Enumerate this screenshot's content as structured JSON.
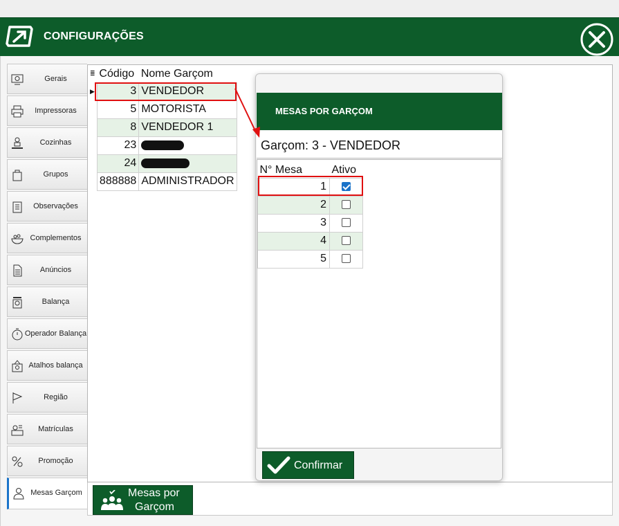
{
  "window": {
    "title": "CONFIGURAÇÕES"
  },
  "sidebar": {
    "items": [
      {
        "label": "Gerais",
        "icon": "gear-screen-icon"
      },
      {
        "label": "Impressoras",
        "icon": "printer-icon"
      },
      {
        "label": "Cozinhas",
        "icon": "chef-icon"
      },
      {
        "label": "Grupos",
        "icon": "groups-icon"
      },
      {
        "label": "Observações",
        "icon": "clipboard-icon"
      },
      {
        "label": "Complementos",
        "icon": "bowl-icon"
      },
      {
        "label": "Anúncios",
        "icon": "document-icon"
      },
      {
        "label": "Balança",
        "icon": "scale-icon"
      },
      {
        "label": "Operador  Balança",
        "icon": "stopwatch-icon"
      },
      {
        "label": "Atalhos balança",
        "icon": "scale-shortcut-icon"
      },
      {
        "label": "Região",
        "icon": "flag-icon"
      },
      {
        "label": "Matrículas",
        "icon": "badge-icon"
      },
      {
        "label": "Promoção",
        "icon": "promotion-icon"
      },
      {
        "label": "Mesas Garçom",
        "icon": "waiter-icon"
      }
    ]
  },
  "waiters_grid": {
    "headers": {
      "code": "Código",
      "name": "Nome Garçom"
    },
    "rows": [
      {
        "code": "3",
        "name": "VENDEDOR"
      },
      {
        "code": "5",
        "name": "MOTORISTA"
      },
      {
        "code": "8",
        "name": "VENDEDOR 1"
      },
      {
        "code": "23",
        "name": ""
      },
      {
        "code": "24",
        "name": ""
      },
      {
        "code": "888888",
        "name": "ADMINISTRADOR"
      }
    ]
  },
  "modal": {
    "title": "MESAS POR GARÇOM",
    "garcom_label": "Garçom: 3 - VENDEDOR",
    "headers": {
      "num": "N° Mesa",
      "active": "Ativo"
    },
    "rows": [
      {
        "num": "1",
        "active": true
      },
      {
        "num": "2",
        "active": false
      },
      {
        "num": "3",
        "active": false
      },
      {
        "num": "4",
        "active": false
      },
      {
        "num": "5",
        "active": false
      }
    ],
    "confirm_label": "Confirmar"
  },
  "bottom": {
    "mesas_button_line1": "Mesas por",
    "mesas_button_line2": "Garçom"
  },
  "colors": {
    "brand_green": "#0d5c2a",
    "row_alt": "#e6f2e6",
    "highlight_red": "#e01010",
    "checkbox_blue": "#1a73c9"
  }
}
